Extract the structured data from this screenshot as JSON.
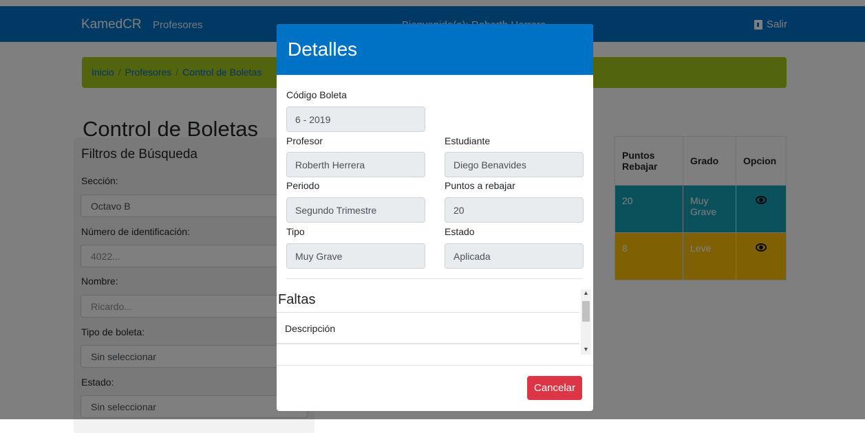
{
  "nav": {
    "brand": "KamedCR",
    "link": "Profesores",
    "welcome": "Bienvenido(a): Roberth Herrera",
    "logout": "Salir"
  },
  "breadcrumb": [
    "Inicio",
    "Profesores",
    "Control de Boletas"
  ],
  "page_title": "Control de Boletas",
  "filters": {
    "title": "Filtros de Búsqueda",
    "seccion_label": "Sección:",
    "seccion_value": "Octavo B",
    "id_label": "Número de identificación:",
    "id_placeholder": "4022...",
    "nombre_label": "Nombre:",
    "nombre_placeholder": "Ricardo...",
    "tipo_label": "Tipo de boleta:",
    "tipo_value": "Sin seleccionar",
    "estado_label": "Estado:",
    "estado_value": "Sin seleccionar"
  },
  "table": {
    "headers": [
      "Puntos Rebajar",
      "Grado",
      "Opcion"
    ],
    "rows": [
      {
        "puntos": "20",
        "grado": "Muy Grave"
      },
      {
        "puntos": "8",
        "grado": "Leve"
      }
    ]
  },
  "modal": {
    "title": "Detalles",
    "codigo_label": "Código Boleta",
    "codigo_value": "6 - 2019",
    "profesor_label": "Profesor",
    "profesor_value": "Roberth Herrera",
    "estudiante_label": "Estudiante",
    "estudiante_value": "Diego Benavides",
    "periodo_label": "Periodo",
    "periodo_value": "Segundo Trimestre",
    "puntos_label": "Puntos a rebajar",
    "puntos_value": "20",
    "tipo_label": "Tipo",
    "tipo_value": "Muy Grave",
    "estado_label": "Estado",
    "estado_value": "Aplicada",
    "faltas_title": "Faltas",
    "faltas_header": "Descripción",
    "cancel_label": "Cancelar"
  },
  "colors": {
    "primary": "#0072c6",
    "breadcrumb": "#a4c81c",
    "teal": "#17a2b8",
    "yellow": "#ffc107",
    "danger": "#dc3545"
  }
}
